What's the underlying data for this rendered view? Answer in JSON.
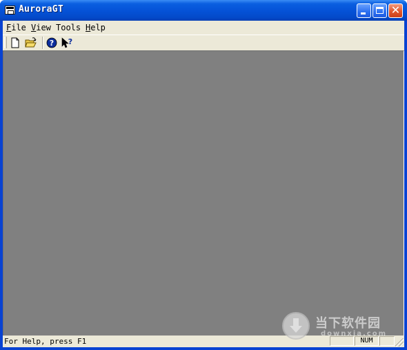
{
  "window": {
    "title": "AuroraGT"
  },
  "menubar": {
    "items": [
      {
        "label": "File",
        "accel": "F",
        "rest": "ile"
      },
      {
        "label": "View",
        "accel": "V",
        "rest": "iew"
      },
      {
        "label": "Tools",
        "accel": "",
        "rest": "Tools"
      },
      {
        "label": "Help",
        "accel": "H",
        "rest": "elp"
      }
    ]
  },
  "toolbar": {
    "buttons": [
      {
        "name": "new",
        "icon": "new-document-icon"
      },
      {
        "name": "open",
        "icon": "open-folder-icon"
      },
      {
        "name": "about",
        "icon": "help-icon"
      },
      {
        "name": "context-help",
        "icon": "whats-this-help-icon"
      }
    ]
  },
  "statusbar": {
    "text": "For Help, press F1",
    "panels": [
      "",
      "NUM",
      ""
    ]
  },
  "watermark": {
    "cn": "当下软件园",
    "domain": "downxia.com"
  },
  "colors": {
    "workspace": "#808080",
    "chrome": "#ece9d8",
    "titlebar": "#0553d8"
  }
}
